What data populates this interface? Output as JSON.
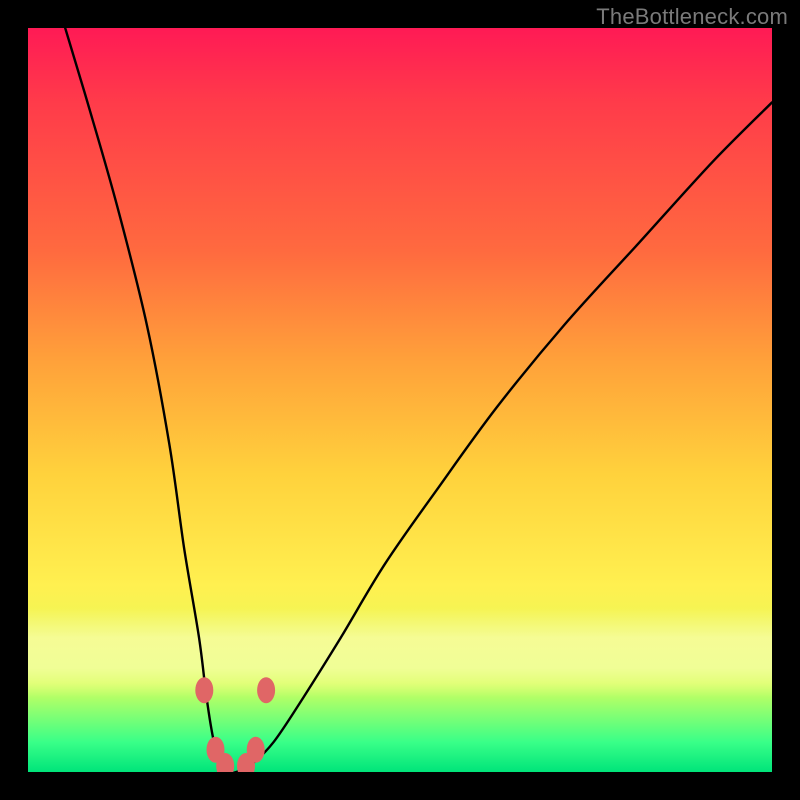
{
  "watermark": "TheBottleneck.com",
  "chart_data": {
    "type": "line",
    "title": "",
    "xlabel": "",
    "ylabel": "",
    "xlim": [
      0,
      100
    ],
    "ylim": [
      0,
      100
    ],
    "grid": false,
    "series": [
      {
        "name": "bottleneck-curve",
        "x": [
          5,
          8,
          12,
          16,
          19,
          21,
          23,
          24,
          25,
          26,
          27,
          28,
          30,
          33,
          37,
          42,
          48,
          55,
          63,
          72,
          82,
          92,
          100
        ],
        "y": [
          100,
          90,
          76,
          60,
          44,
          30,
          18,
          10,
          4,
          1,
          0,
          0,
          1,
          4,
          10,
          18,
          28,
          38,
          49,
          60,
          71,
          82,
          90
        ]
      }
    ],
    "markers": [
      {
        "name": "left-upper",
        "x": 23.7,
        "y": 11
      },
      {
        "name": "left-lower",
        "x": 25.2,
        "y": 3
      },
      {
        "name": "min-left",
        "x": 26.5,
        "y": 0.8
      },
      {
        "name": "min-right",
        "x": 29.3,
        "y": 0.8
      },
      {
        "name": "right-lower",
        "x": 30.6,
        "y": 3
      },
      {
        "name": "right-upper",
        "x": 32.0,
        "y": 11
      }
    ],
    "colors": {
      "curve": "#000000",
      "marker_fill": "#e06666",
      "marker_stroke": "#e06666"
    }
  }
}
